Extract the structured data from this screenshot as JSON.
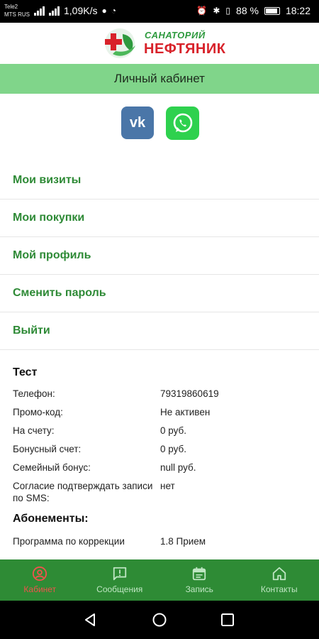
{
  "status_bar": {
    "carrier1": "Tele2",
    "carrier2": "MTS RUS",
    "net_speed": "1,09K/s",
    "battery": "88 %",
    "time": "18:22"
  },
  "header": {
    "brand_top": "САНАТОРИЙ",
    "brand_main": "НЕФТЯНИК"
  },
  "titlebar": {
    "title": "Личный кабинет"
  },
  "social": {
    "vk_label": "vk"
  },
  "menu": {
    "items": [
      {
        "label": "Мои визиты"
      },
      {
        "label": "Мои покупки"
      },
      {
        "label": "Мой профиль"
      },
      {
        "label": "Сменить пароль"
      },
      {
        "label": "Выйти"
      }
    ]
  },
  "profile": {
    "name": "Тест",
    "rows": [
      {
        "key": "Телефон:",
        "value": "79319860619"
      },
      {
        "key": "Промо-код:",
        "value": "Не активен"
      },
      {
        "key": "На счету:",
        "value": "0 руб."
      },
      {
        "key": "Бонусный счет:",
        "value": "0 руб."
      },
      {
        "key": "Семейный бонус:",
        "value": "null руб."
      },
      {
        "key": "Согласие подтверждать записи по SMS:",
        "value": "нет"
      }
    ],
    "subscriptions_title": "Абонементы:",
    "subscriptions": [
      {
        "key": "Программа по коррекции",
        "value": "1.8 Прием"
      }
    ]
  },
  "bottom_nav": {
    "items": [
      {
        "label": "Кабинет",
        "icon": "person-icon",
        "active": true
      },
      {
        "label": "Сообщения",
        "icon": "message-icon",
        "active": false
      },
      {
        "label": "Запись",
        "icon": "calendar-icon",
        "active": false
      },
      {
        "label": "Контакты",
        "icon": "home-icon",
        "active": false
      }
    ]
  },
  "colors": {
    "accent_green": "#2e8b35",
    "title_bar": "#80d58a",
    "menu_text": "#2e8a36",
    "active_nav": "#f0524d",
    "brand_red": "#d8222a"
  }
}
